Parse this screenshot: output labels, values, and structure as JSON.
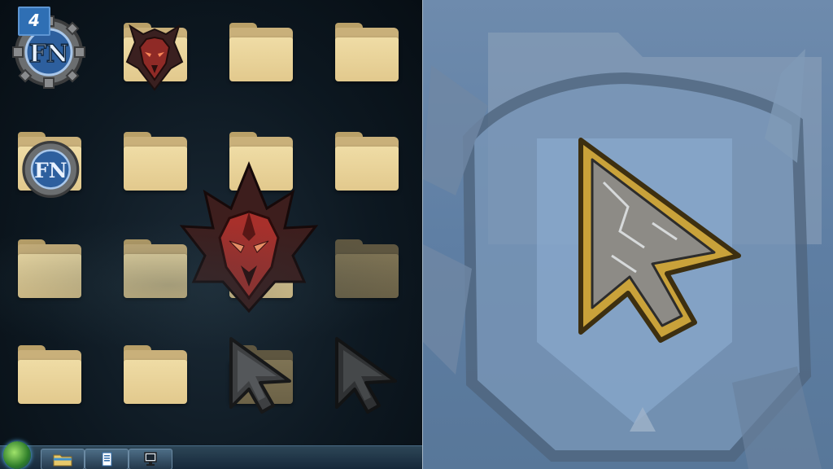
{
  "desktop": {
    "badge_label": "4",
    "icons": [
      {
        "kind": "emblem-fn",
        "name": "fn-emblem-icon"
      },
      {
        "kind": "folder-demon",
        "name": "demon-folder-icon"
      },
      {
        "kind": "folder",
        "name": "folder-icon"
      },
      {
        "kind": "folder",
        "name": "folder-icon"
      },
      {
        "kind": "folder-fn",
        "name": "fn-folder-icon"
      },
      {
        "kind": "folder",
        "name": "folder-icon"
      },
      {
        "kind": "folder",
        "name": "folder-icon"
      },
      {
        "kind": "folder",
        "name": "folder-icon"
      },
      {
        "kind": "folder",
        "name": "folder-icon"
      },
      {
        "kind": "folder",
        "name": "folder-icon"
      },
      {
        "kind": "demon-large",
        "name": "demon-emblem-icon"
      },
      {
        "kind": "folder-dim",
        "name": "folder-icon"
      },
      {
        "kind": "folder",
        "name": "folder-icon"
      },
      {
        "kind": "folder",
        "name": "folder-icon"
      },
      {
        "kind": "cursor-folder",
        "name": "cursor-folder-icon"
      },
      {
        "kind": "cursor",
        "name": "cursor-arrow-icon"
      }
    ]
  },
  "taskbar": {
    "items": [
      "start-orb-icon",
      "folder-taskbar-icon",
      "document-taskbar-icon",
      "computer-taskbar-icon"
    ]
  },
  "colors": {
    "folder": "#e2c98d",
    "demon_red": "#a8302b",
    "fn_blue": "#2f5f9f",
    "zoom_bg": "#6585a8",
    "cursor_gold": "#c9a23a"
  }
}
